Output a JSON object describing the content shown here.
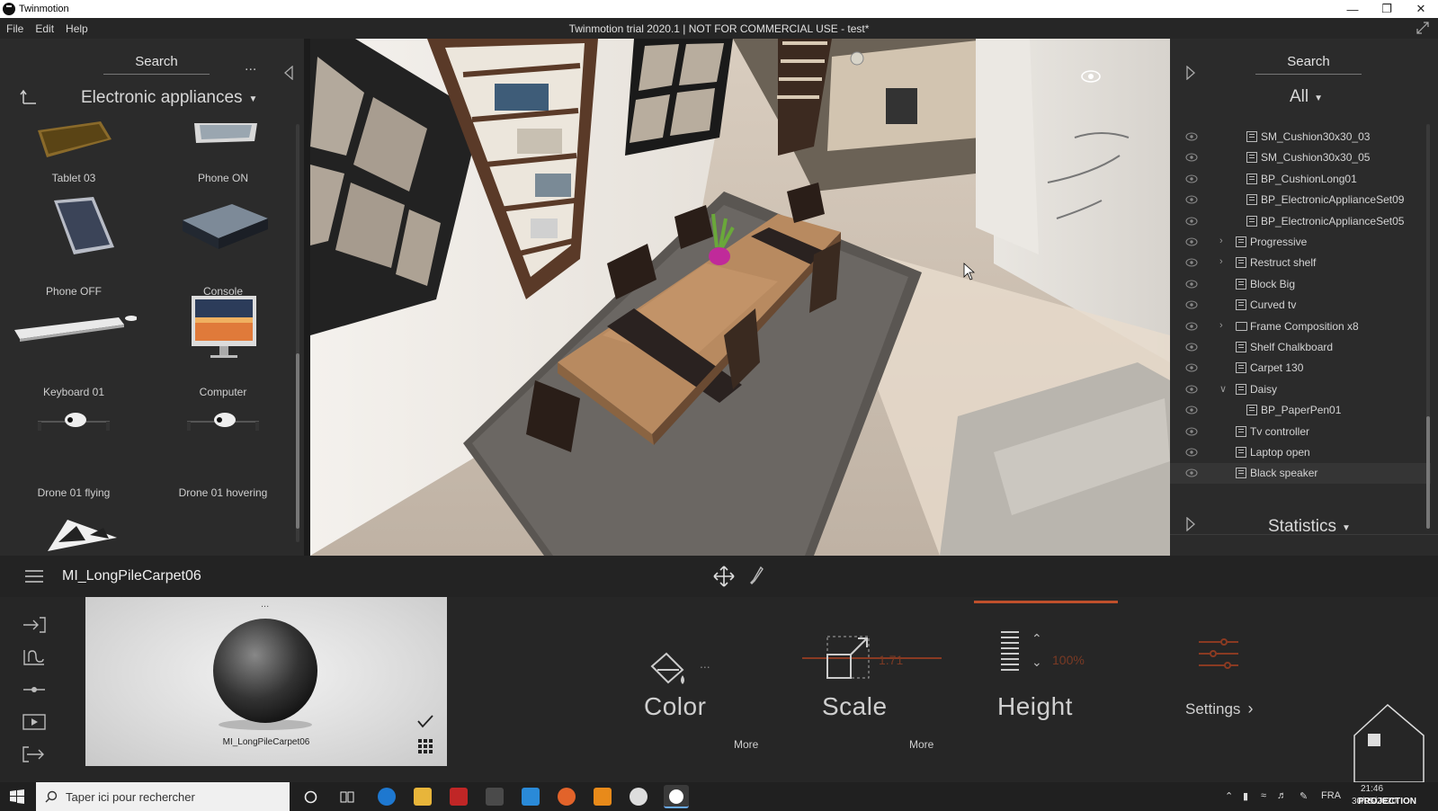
{
  "window": {
    "title": "Twinmotion",
    "app_title": "Twinmotion trial 2020.1 | NOT FOR COMMERCIAL USE - test*"
  },
  "menu": [
    "File",
    "Edit",
    "Help"
  ],
  "library": {
    "search_label": "Search",
    "more": "...",
    "category": "Electronic appliances",
    "items": [
      {
        "label": "Tablet 03",
        "icon": "tablet-icon"
      },
      {
        "label": "Phone ON",
        "icon": "phone-icon"
      },
      {
        "label": "Phone OFF",
        "icon": "phone-icon"
      },
      {
        "label": "Console",
        "icon": "console-icon"
      },
      {
        "label": "Keyboard 01",
        "icon": "keyboard-icon"
      },
      {
        "label": "Computer",
        "icon": "monitor-icon"
      },
      {
        "label": "Drone 01 flying",
        "icon": "drone-icon"
      },
      {
        "label": "Drone 01 hovering",
        "icon": "drone-icon"
      }
    ]
  },
  "scene_graph": {
    "search_label": "Search",
    "filter": "All",
    "nodes": [
      {
        "label": "SM_Cushion30x30_03",
        "type": "object",
        "depth": 2,
        "expander": ""
      },
      {
        "label": "SM_Cushion30x30_05",
        "type": "object",
        "depth": 2,
        "expander": ""
      },
      {
        "label": "BP_CushionLong01",
        "type": "object",
        "depth": 2,
        "expander": ""
      },
      {
        "label": "BP_ElectronicApplianceSet09",
        "type": "object",
        "depth": 2,
        "expander": ""
      },
      {
        "label": "BP_ElectronicApplianceSet05",
        "type": "object",
        "depth": 2,
        "expander": ""
      },
      {
        "label": "Progressive",
        "type": "object",
        "depth": 1,
        "expander": ">"
      },
      {
        "label": "Restruct shelf",
        "type": "object",
        "depth": 1,
        "expander": ">"
      },
      {
        "label": "Block Big",
        "type": "object",
        "depth": 1,
        "expander": ""
      },
      {
        "label": "Curved tv",
        "type": "object",
        "depth": 1,
        "expander": ""
      },
      {
        "label": "Frame Composition x8",
        "type": "folder",
        "depth": 1,
        "expander": ">"
      },
      {
        "label": "Shelf Chalkboard",
        "type": "object",
        "depth": 1,
        "expander": ""
      },
      {
        "label": "Carpet 130",
        "type": "object",
        "depth": 1,
        "expander": ""
      },
      {
        "label": "Daisy",
        "type": "object",
        "depth": 1,
        "expander": "v"
      },
      {
        "label": "BP_PaperPen01",
        "type": "object",
        "depth": 2,
        "expander": ""
      },
      {
        "label": "Tv controller",
        "type": "object",
        "depth": 1,
        "expander": ""
      },
      {
        "label": "Laptop open",
        "type": "object",
        "depth": 1,
        "expander": ""
      },
      {
        "label": "Black speaker",
        "type": "object",
        "depth": 1,
        "expander": "",
        "selected": true
      }
    ],
    "statistics_label": "Statistics"
  },
  "material": {
    "name": "MI_LongPileCarpet06",
    "preview_label": "MI_LongPileCarpet06",
    "preview_more": "...",
    "color_label": "Color",
    "color_more": "...",
    "scale_label": "Scale",
    "scale_value": "1.71",
    "height_label": "Height",
    "height_value": "100%",
    "settings_label": "Settings",
    "more_1": "More",
    "more_2": "More",
    "accent_color": "#c0502c"
  },
  "taskbar": {
    "search_placeholder": "Taper ici pour rechercher",
    "language": "FRA",
    "time": "21:46",
    "date": "30/05/2020",
    "watermark": "PROJECTION"
  }
}
